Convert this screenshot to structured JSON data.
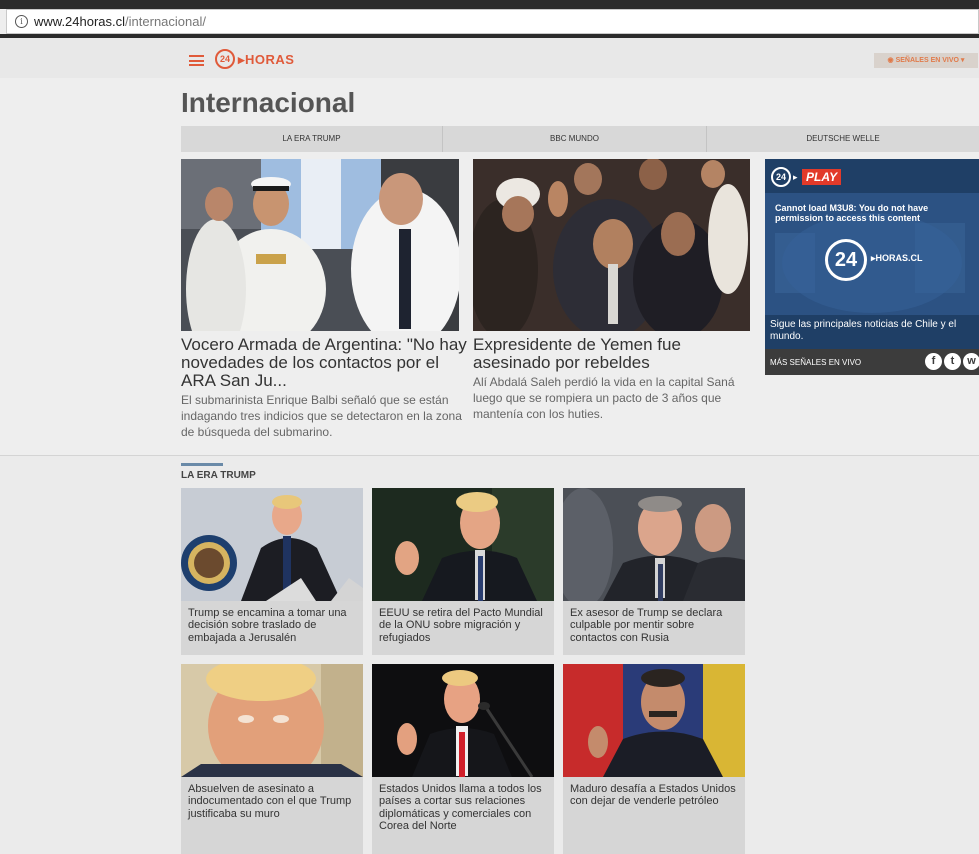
{
  "browser": {
    "url_host": "www.24horas.cl",
    "url_path": "/internacional/"
  },
  "header": {
    "logo_number": "24",
    "logo_text": "▸HORAS",
    "live_button": "◉ SEÑALES EN VIVO ▾"
  },
  "page": {
    "title": "Internacional"
  },
  "tabs": [
    {
      "label": "LA ERA TRUMP"
    },
    {
      "label": "BBC MUNDO"
    },
    {
      "label": "DEUTSCHE WELLE"
    }
  ],
  "featured": [
    {
      "title": "Vocero Armada de Argentina: \"No hay novedades de los contactos por el ARA San Ju...",
      "summary": "El submarinista Enrique Balbi señaló que se están indagando tres indicios que se detectaron en la zona de búsqueda del submarino."
    },
    {
      "title": "Expresidente de Yemen fue asesinado por rebeldes",
      "summary": "Alí Abdalá Saleh perdió la vida en la capital Saná luego que se rompiera un pacto de 3 años que mantenía con los huties."
    }
  ],
  "play_widget": {
    "logo_number": "24",
    "brand": "PLAY",
    "error": "Cannot load M3U8: You do not have permission to access this content",
    "player_logo_number": "24",
    "player_logo_text": "▸HORAS.CL",
    "caption": "Sigue las principales noticias de Chile y el mundo.",
    "more_label": "MÁS SEÑALES EN VIVO",
    "social": [
      "f",
      "t",
      "w"
    ]
  },
  "section": {
    "title": "LA ERA TRUMP",
    "cards": [
      {
        "title": "Trump se encamina a tomar una decisión sobre traslado de embajada a Jerusalén"
      },
      {
        "title": "EEUU se retira del Pacto Mundial de la ONU sobre migración y refugiados"
      },
      {
        "title": "Ex asesor de Trump se declara culpable por mentir sobre contactos con Rusia"
      },
      {
        "title": "Absuelven de asesinato a indocumentado con el que Trump justificaba su muro"
      },
      {
        "title": "Estados Unidos llama a todos los países a cortar sus relaciones diplomáticas y comerciales con Corea del Norte"
      },
      {
        "title": "Maduro desafía a Estados Unidos con dejar de venderle petróleo"
      }
    ]
  },
  "colors": {
    "brand": "#e05a3a",
    "play_bg": "#1f3f66",
    "section_bar": "#6a8aa8"
  }
}
